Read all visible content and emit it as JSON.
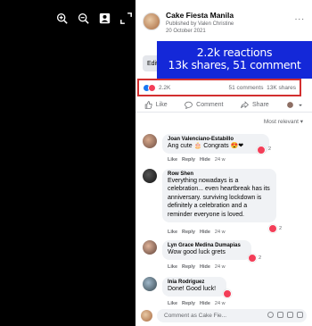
{
  "post": {
    "page_name": "Cake Fiesta Manila",
    "published_by": "Published by Valen Christine",
    "date": "20 October 2021",
    "edit_label": "Edit",
    "more_label": "..."
  },
  "overlay": {
    "line1": "2.2k reactions",
    "line2": "13k shares, 51 comment"
  },
  "stats": {
    "reactions": "2.2K",
    "comments": "51 comments",
    "shares": "13K shares"
  },
  "actions": {
    "like": "Like",
    "comment": "Comment",
    "share": "Share"
  },
  "sort_label": "Most relevant",
  "comments": [
    {
      "name": "Joan Valenciano-Estabillo",
      "text": "Ang cute 🎂 Congrats 😍❤",
      "reaction_count": "2",
      "like": "Like",
      "reply": "Reply",
      "hide": "Hide",
      "time": "24 w"
    },
    {
      "name": "Row Shen",
      "text": "Everything nowadays is a celebration... even heartbreak has its anniversary. surviving lockdown is definitely a celebration and a reminder everyone is loved.",
      "reaction_count": "2",
      "like": "Like",
      "reply": "Reply",
      "hide": "Hide",
      "time": "24 w"
    },
    {
      "name": "Lyn Grace Medina Dumapias",
      "text": "Wow good luck grets",
      "reaction_count": "2",
      "like": "Like",
      "reply": "Reply",
      "hide": "Hide",
      "time": "24 w"
    },
    {
      "name": "Inia Rodriguez",
      "text": "Done! Good luck!",
      "like": "Like",
      "reply": "Reply",
      "hide": "Hide",
      "time": "24 w"
    }
  ],
  "composer": {
    "placeholder": "Comment as Cake Fie..."
  },
  "colors": {
    "overlay_bg": "#1428d8",
    "highlight_border": "#d32f2f",
    "like_blue": "#1877f2",
    "love_red": "#f33e58"
  }
}
